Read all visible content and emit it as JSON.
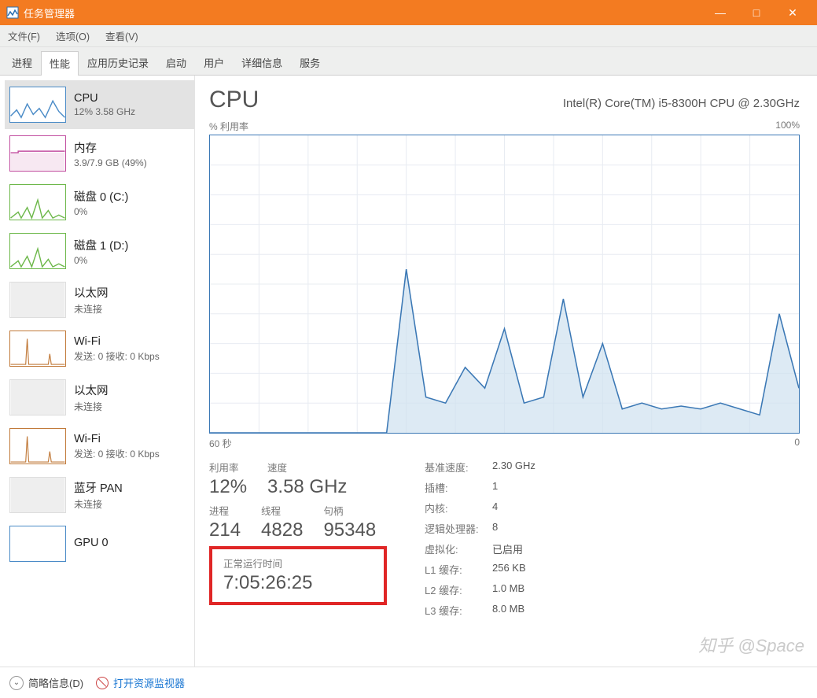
{
  "window": {
    "title": "任务管理器",
    "minimize": "—",
    "maximize": "□",
    "close": "✕"
  },
  "menu": {
    "file": "文件(F)",
    "options": "选项(O)",
    "view": "查看(V)"
  },
  "tabs": [
    "进程",
    "性能",
    "应用历史记录",
    "启动",
    "用户",
    "详细信息",
    "服务"
  ],
  "active_tab": 1,
  "sidebar": [
    {
      "title": "CPU",
      "sub": "12% 3.58 GHz",
      "color": "#4a8bc7",
      "kind": "cpu"
    },
    {
      "title": "内存",
      "sub": "3.9/7.9 GB (49%)",
      "color": "#c24fa0",
      "kind": "mem"
    },
    {
      "title": "磁盘 0 (C:)",
      "sub": "0%",
      "color": "#6db84a",
      "kind": "disk"
    },
    {
      "title": "磁盘 1 (D:)",
      "sub": "0%",
      "color": "#6db84a",
      "kind": "disk"
    },
    {
      "title": "以太网",
      "sub": "未连接",
      "color": "#aaa",
      "kind": "eth-off"
    },
    {
      "title": "Wi-Fi",
      "sub": "发送: 0 接收: 0 Kbps",
      "color": "#c17a3a",
      "kind": "wifi"
    },
    {
      "title": "以太网",
      "sub": "未连接",
      "color": "#aaa",
      "kind": "eth-off"
    },
    {
      "title": "Wi-Fi",
      "sub": "发送: 0 接收: 0 Kbps",
      "color": "#c17a3a",
      "kind": "wifi2"
    },
    {
      "title": "蓝牙 PAN",
      "sub": "未连接",
      "color": "#aaa",
      "kind": "eth-off"
    },
    {
      "title": "GPU 0",
      "sub": "",
      "color": "#4a8bc7",
      "kind": "gpu"
    }
  ],
  "main": {
    "title": "CPU",
    "cpu_name": "Intel(R) Core(TM) i5-8300H CPU @ 2.30GHz",
    "util_label": "% 利用率",
    "util_max": "100%",
    "x_left": "60 秒",
    "x_right": "0"
  },
  "stats": {
    "util_label": "利用率",
    "util_value": "12%",
    "speed_label": "速度",
    "speed_value": "3.58 GHz",
    "proc_label": "进程",
    "proc_value": "214",
    "thread_label": "线程",
    "thread_value": "4828",
    "handle_label": "句柄",
    "handle_value": "95348",
    "uptime_label": "正常运行时间",
    "uptime_value": "7:05:26:25"
  },
  "specs": [
    {
      "k": "基准速度:",
      "v": "2.30 GHz"
    },
    {
      "k": "插槽:",
      "v": "1"
    },
    {
      "k": "内核:",
      "v": "4"
    },
    {
      "k": "逻辑处理器:",
      "v": "8"
    },
    {
      "k": "虚拟化:",
      "v": "已启用"
    },
    {
      "k": "L1 缓存:",
      "v": "256 KB"
    },
    {
      "k": "L2 缓存:",
      "v": "1.0 MB"
    },
    {
      "k": "L3 缓存:",
      "v": "8.0 MB"
    }
  ],
  "footer": {
    "collapse": "简略信息(D)",
    "resmon": "打开资源监视器"
  },
  "watermark": "知乎 @Space",
  "chart_data": {
    "type": "area",
    "title": "CPU % 利用率",
    "xlabel": "秒",
    "ylabel": "% 利用率",
    "ylim": [
      0,
      100
    ],
    "x": [
      60,
      58,
      56,
      54,
      52,
      50,
      48,
      46,
      44,
      42,
      40,
      38,
      36,
      34,
      32,
      30,
      28,
      26,
      24,
      22,
      20,
      18,
      16,
      14,
      12,
      10,
      8,
      6,
      4,
      2,
      0
    ],
    "values": [
      0,
      0,
      0,
      0,
      0,
      0,
      0,
      0,
      0,
      0,
      55,
      12,
      10,
      22,
      15,
      35,
      10,
      12,
      45,
      12,
      30,
      8,
      10,
      8,
      9,
      8,
      10,
      8,
      6,
      40,
      15
    ]
  }
}
